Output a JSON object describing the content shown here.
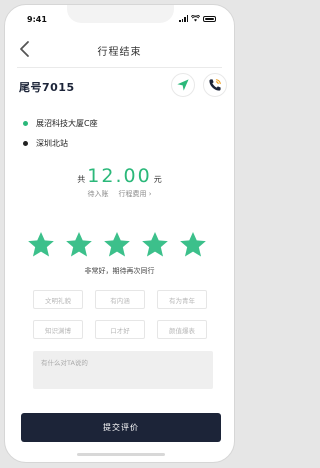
{
  "status_bar": {
    "time": "9:41"
  },
  "header": {
    "title": "行程结束",
    "back_icon": "chevron-left-icon"
  },
  "driver": {
    "plate": "尾号7015",
    "navigate_icon": "navigation-arrow-icon",
    "call_icon": "phone-call-icon",
    "accent_color": "#2bb87a"
  },
  "route": {
    "start": "展沼科技大厦C座",
    "end": "深圳北站"
  },
  "fare": {
    "prefix": "共",
    "amount": "12.00",
    "unit": "元",
    "pending_label": "待入账",
    "detail_label": "行程费用"
  },
  "rating": {
    "stars": 5,
    "max": 5,
    "text": "非常好，期待再次同行",
    "star_color": "#3cc08b"
  },
  "tags": [
    "文明礼貌",
    "有内涵",
    "有为青年",
    "知识渊博",
    "口才好",
    "颜值爆表"
  ],
  "comment": {
    "placeholder": "有什么对TA说的"
  },
  "submit": {
    "label": "提交评价",
    "color": "#1c2438"
  }
}
